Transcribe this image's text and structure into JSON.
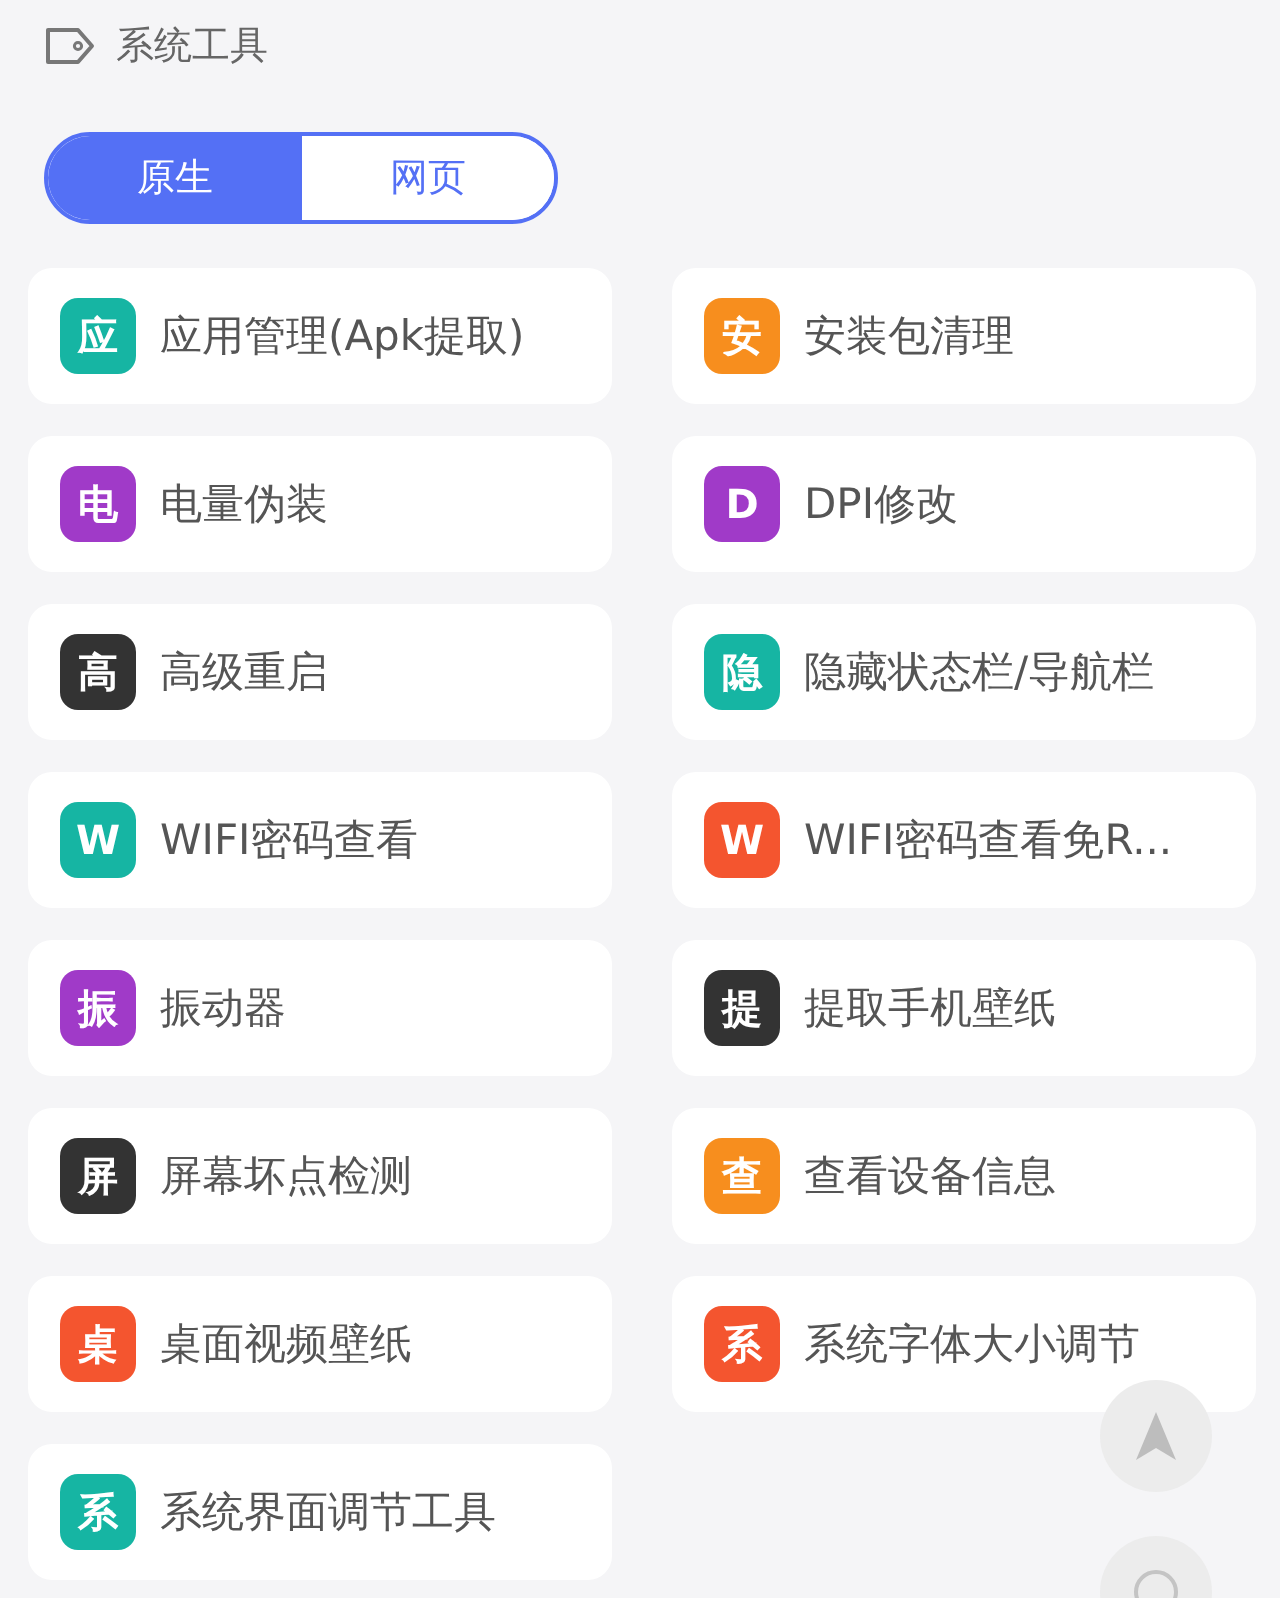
{
  "header": {
    "title": "系统工具"
  },
  "segments": [
    {
      "label": "原生",
      "selected": true
    },
    {
      "label": "网页",
      "selected": false
    }
  ],
  "tools": [
    {
      "letter": "应",
      "label": "应用管理(Apk提取)",
      "color": "#16b5a3"
    },
    {
      "letter": "安",
      "label": "安装包清理",
      "color": "#f78e1e"
    },
    {
      "letter": "电",
      "label": "电量伪装",
      "color": "#a03ac8"
    },
    {
      "letter": "D",
      "label": "DPI修改",
      "color": "#a03ac8"
    },
    {
      "letter": "高",
      "label": "高级重启",
      "color": "#333333"
    },
    {
      "letter": "隐",
      "label": "隐藏状态栏/导航栏",
      "color": "#16b5a3"
    },
    {
      "letter": "W",
      "label": "WIFI密码查看",
      "color": "#16b5a3"
    },
    {
      "letter": "W",
      "label": "WIFI密码查看免R...",
      "color": "#f4552f"
    },
    {
      "letter": "振",
      "label": "振动器",
      "color": "#a03ac8"
    },
    {
      "letter": "提",
      "label": "提取手机壁纸",
      "color": "#333333"
    },
    {
      "letter": "屏",
      "label": "屏幕坏点检测",
      "color": "#333333"
    },
    {
      "letter": "查",
      "label": "查看设备信息",
      "color": "#f78e1e"
    },
    {
      "letter": "桌",
      "label": "桌面视频壁纸",
      "color": "#f4552f"
    },
    {
      "letter": "系",
      "label": "系统字体大小调节",
      "color": "#f4552f"
    },
    {
      "letter": "系",
      "label": "系统界面调节工具",
      "color": "#16b5a3"
    }
  ]
}
